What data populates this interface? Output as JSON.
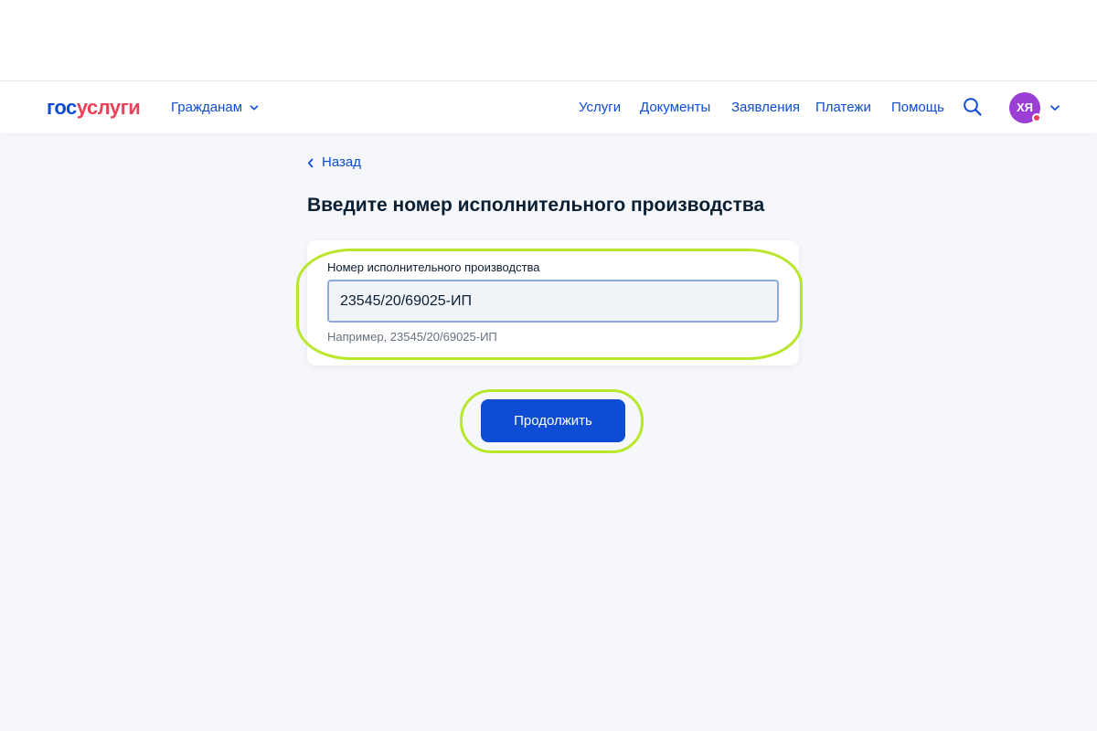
{
  "header": {
    "logo_gos": "гос",
    "logo_uslugi": "услуги",
    "audience_label": "Гражданам",
    "nav": [
      {
        "label": "Услуги"
      },
      {
        "label": "Документы"
      },
      {
        "label": "Заявления"
      },
      {
        "label": "Платежи"
      },
      {
        "label": "Помощь"
      }
    ],
    "avatar_initials": "ХЯ",
    "icons": {
      "search": "search-icon",
      "chevron": "chevron-down-icon",
      "notification": "notification-dot-icon"
    }
  },
  "page": {
    "back_label": "Назад",
    "title": "Введите номер исполнительного производства"
  },
  "form": {
    "field_label": "Номер исполнительного производства",
    "field_value": "23545/20/69025-ИП",
    "field_hint": "Например, 23545/20/69025-ИП"
  },
  "actions": {
    "continue_label": "Продолжить"
  },
  "colors": {
    "brand_blue": "#0d4cd3",
    "brand_red": "#ee3f58",
    "avatar": "#9b3fd4",
    "highlight": "#b8e62b"
  }
}
